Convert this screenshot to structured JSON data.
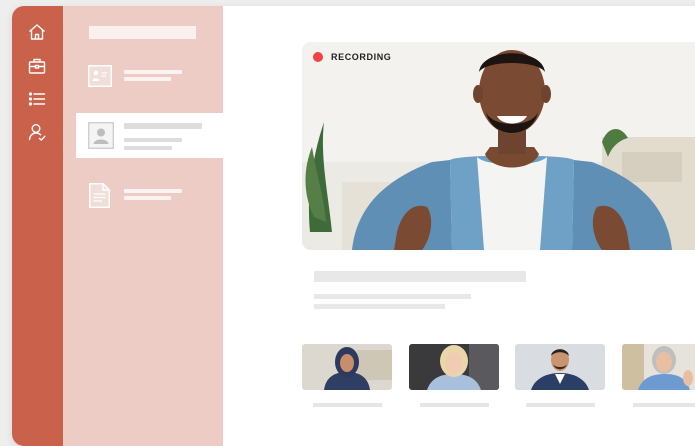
{
  "recording": {
    "label": "RECORDING",
    "color": "#ef4444"
  },
  "colors": {
    "rail": "#c9614b",
    "panel": "#ecccc4",
    "active_item": "#ffffff"
  },
  "rail_icons": [
    "home-icon",
    "briefcase-icon",
    "list-icon",
    "user-icon"
  ],
  "panel_items": [
    {
      "icon": "presentation-icon",
      "active": false
    },
    {
      "icon": "contact-card-icon",
      "active": true
    },
    {
      "icon": "document-icon",
      "active": false
    }
  ],
  "participants": [
    {
      "icon": "participant-woman-hijab"
    },
    {
      "icon": "participant-woman-blonde"
    },
    {
      "icon": "participant-man-suit"
    },
    {
      "icon": "participant-woman-gray-hair"
    }
  ]
}
